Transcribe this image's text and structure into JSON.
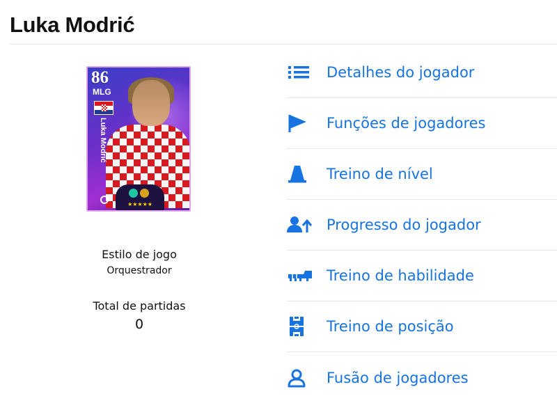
{
  "page": {
    "title": "Luka Modrić"
  },
  "card": {
    "rating": "86",
    "position": "MLG",
    "name": "Luka Modrić"
  },
  "stats": {
    "playstyle_label": "Estilo de jogo",
    "playstyle_value": "Orquestrador",
    "matches_label": "Total de partidas",
    "matches_value": "0"
  },
  "menu": {
    "items": [
      {
        "label": "Detalhes do jogador",
        "icon": "list-icon"
      },
      {
        "label": "Funções de jogadores",
        "icon": "flag-icon"
      },
      {
        "label": "Treino de nível",
        "icon": "cone-icon"
      },
      {
        "label": "Progresso do jogador",
        "icon": "person-up-icon"
      },
      {
        "label": "Treino de habilidade",
        "icon": "boot-icon"
      },
      {
        "label": "Treino de posição",
        "icon": "pitch-icon"
      },
      {
        "label": "Fusão de jogadores",
        "icon": "user-circle-icon"
      }
    ]
  },
  "colors": {
    "accent": "#1673e0",
    "divider": "#e6e6e6",
    "text": "#111111"
  }
}
